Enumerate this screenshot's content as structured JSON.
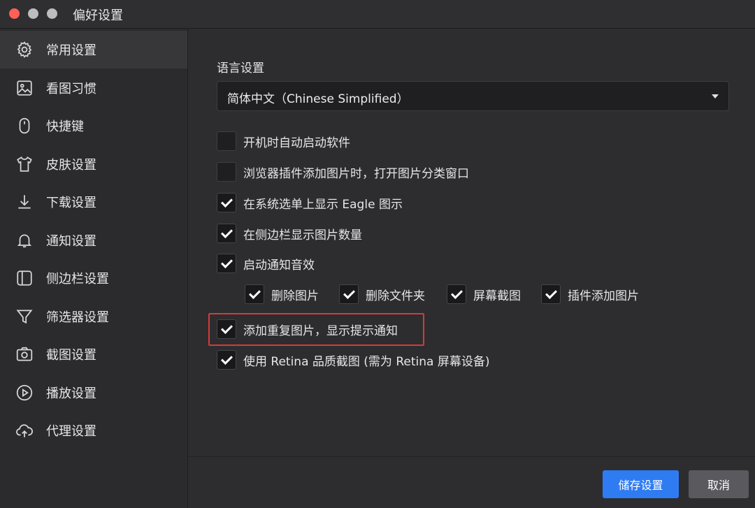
{
  "window": {
    "title": "偏好设置"
  },
  "sidebar": {
    "items": [
      {
        "label": "常用设置",
        "icon": "gear-icon",
        "active": true
      },
      {
        "label": "看图习惯",
        "icon": "image-icon"
      },
      {
        "label": "快捷键",
        "icon": "mouse-icon"
      },
      {
        "label": "皮肤设置",
        "icon": "shirt-icon"
      },
      {
        "label": "下载设置",
        "icon": "download-icon"
      },
      {
        "label": "通知设置",
        "icon": "bell-icon"
      },
      {
        "label": "侧边栏设置",
        "icon": "sidebar-icon"
      },
      {
        "label": "筛选器设置",
        "icon": "filter-icon"
      },
      {
        "label": "截图设置",
        "icon": "camera-icon"
      },
      {
        "label": "播放设置",
        "icon": "play-icon"
      },
      {
        "label": "代理设置",
        "icon": "cloud-upload-icon"
      }
    ]
  },
  "main": {
    "language": {
      "title": "语言设置",
      "selected": "简体中文（Chinese Simplified）"
    },
    "options": [
      {
        "label": "开机时自动启动软件",
        "checked": false
      },
      {
        "label": "浏览器插件添加图片时，打开图片分类窗口",
        "checked": false
      },
      {
        "label": "在系统选单上显示 Eagle 图示",
        "checked": true
      },
      {
        "label": "在侧边栏显示图片数量",
        "checked": true
      },
      {
        "label": "启动通知音效",
        "checked": true
      }
    ],
    "sound_options": [
      {
        "label": "删除图片",
        "checked": true
      },
      {
        "label": "删除文件夹",
        "checked": true
      },
      {
        "label": "屏幕截图",
        "checked": true
      },
      {
        "label": "插件添加图片",
        "checked": true
      }
    ],
    "extra_options": [
      {
        "label": "添加重复图片，显示提示通知",
        "checked": true
      },
      {
        "label": "使用 Retina 品质截图 (需为 Retina 屏幕设备)",
        "checked": true
      }
    ]
  },
  "footer": {
    "save_label": "储存设置",
    "cancel_label": "取消"
  },
  "colors": {
    "accent": "#2f7bf2",
    "highlight": "#d63a3a",
    "background": "#2d2d30"
  }
}
